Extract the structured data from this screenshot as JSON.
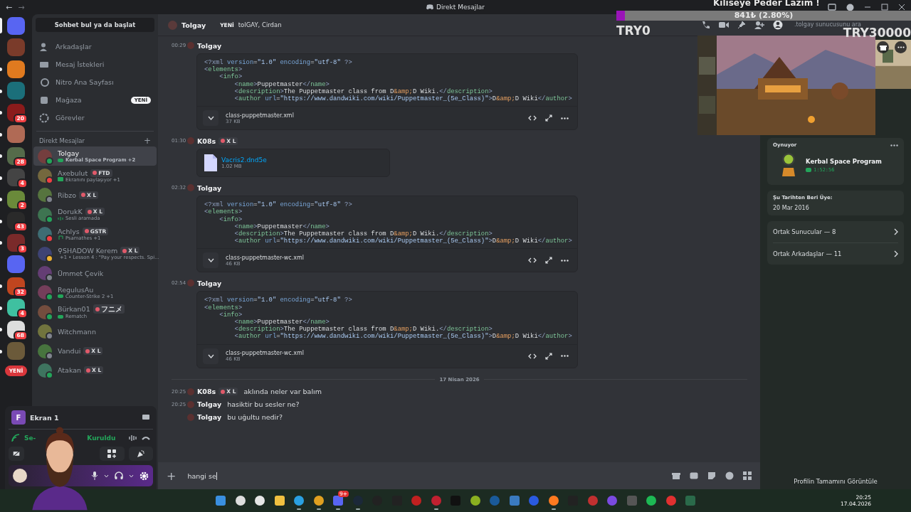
{
  "window": {
    "title": "Direkt Mesajlar",
    "back": "←",
    "forward": "→"
  },
  "overlay": {
    "goal_title": "Kiliseye Peder Lazım !",
    "goal_amount": "841₺ (2.80%)",
    "level": 0.028,
    "goal_min": "TRY0",
    "goal_max": "TRY30000"
  },
  "servers": [
    {
      "unread": false,
      "selected": true
    },
    {
      "unread": false,
      "selected": false
    },
    {
      "unread": true,
      "selected": false
    },
    {
      "unread": true,
      "selected": false
    },
    {
      "unread": true,
      "badge": "20",
      "selected": false
    },
    {
      "unread": true,
      "selected": false
    },
    {
      "unread": true,
      "badge": "28",
      "selected": false
    },
    {
      "unread": true,
      "badge": "4",
      "selected": false
    },
    {
      "unread": true,
      "badge": "2",
      "selected": false
    },
    {
      "unread": true,
      "badge": "43",
      "selected": false
    },
    {
      "unread": true,
      "badge": "3",
      "selected": false
    },
    {
      "unread": false,
      "selected": false
    },
    {
      "unread": true,
      "badge": "32",
      "selected": false
    },
    {
      "unread": true,
      "badge": "4",
      "selected": false
    },
    {
      "unread": true,
      "badge": "68",
      "selected": false
    },
    {
      "unread": true,
      "selected": false
    }
  ],
  "new_button": "YENİ",
  "sidebar": {
    "search": "Sohbet bul ya da başlat",
    "nav": [
      {
        "label": "Arkadaşlar"
      },
      {
        "label": "Mesaj İstekleri"
      },
      {
        "label": "Nitro Ana Sayfası"
      },
      {
        "label": "Mağaza",
        "badge": "YENİ"
      },
      {
        "label": "Görevler"
      }
    ],
    "dm_header": "Direkt Mesajlar",
    "dm_add": "+",
    "dms": [
      {
        "name": "Tolgay",
        "color": "#23a55a",
        "activity": {
          "kind": "game",
          "text": "Kerbal Space Program +2"
        },
        "selected": true
      },
      {
        "name": "Axebulut",
        "color": "#f23f43",
        "tag": "FTD",
        "activity": {
          "kind": "screen",
          "text": "Ekranını paylaşıyor +1"
        },
        "selected": false
      },
      {
        "name": "Ribzo",
        "color": "#80848e",
        "tag": "X L",
        "selected": false
      },
      {
        "name": "DorukK",
        "color": "#23a55a",
        "tag": "X L",
        "activity": {
          "kind": "voice",
          "text": "Sesli aramada"
        },
        "selected": false
      },
      {
        "name": "Achlys",
        "color": "#f23f43",
        "tag": "GSTR",
        "activity": {
          "kind": "music",
          "text": "Psamathes +1"
        },
        "selected": false
      },
      {
        "name": "⚲SHADOW Kerem",
        "color": "#f0b232",
        "tag": "X L",
        "activity": {
          "kind": "music",
          "text": "+1 • Lesson 4 : \"Pay your respects. Spi..."
        },
        "selected": false
      },
      {
        "name": "Ümmet Çevik",
        "color": "#80848e",
        "selected": false
      },
      {
        "name": "RegulusAu",
        "color": "#23a55a",
        "activity": {
          "kind": "game",
          "text": "Counter-Strike 2 +1"
        },
        "selected": false
      },
      {
        "name": "Bürkan01",
        "color": "#23a55a",
        "tag": "フニメ",
        "activity": {
          "kind": "game",
          "text": "Rematch"
        },
        "selected": false
      },
      {
        "name": "Witchmann",
        "color": "#80848e",
        "selected": false
      },
      {
        "name": "Vandui",
        "color": "#80848e",
        "tag": "X L",
        "selected": false
      },
      {
        "name": "Atakan",
        "color": "#23a55a",
        "tag": "X L",
        "selected": false
      }
    ]
  },
  "voice": {
    "stream_title": "Ekran 1",
    "stream_initial": "F",
    "status_start": "Se-",
    "status_end": "Kuruldu"
  },
  "chat": {
    "name": "Tolgay",
    "badge": "YENİ",
    "members": "tolGAY, Cirdan",
    "search": ".tolgay sunucusunu ara",
    "messages": [
      {
        "kind": "code",
        "time": "00:29",
        "author": "Tolgay",
        "file": "class-puppetmaster.xml",
        "size": "37 KB",
        "lines": [
          "<?xml version=\"1.0\" encoding=\"utf-8\" ?>",
          "<elements>",
          "    <info>",
          "        <name>Puppetmaster</name>",
          "        <description>The Puppetmaster class from D&amp;D Wiki.</description>",
          "        <author url=\"https://www.dandwiki.com/wiki/Puppetmaster_(5e_Class)\">D&amp;D Wiki</author>"
        ]
      },
      {
        "kind": "file",
        "time": "01:30",
        "author": "K08s",
        "tag": "X L",
        "file": "Vacris2.dnd5e",
        "size": "1.02 MB"
      },
      {
        "kind": "code",
        "time": "02:32",
        "author": "Tolgay",
        "file": "class-puppetmaster-wc.xml",
        "size": "46 KB",
        "lines": [
          "<?xml version=\"1.0\" encoding=\"utf-8\" ?>",
          "<elements>",
          "    <info>",
          "        <name>Puppetmaster</name>",
          "        <description>The Puppetmaster class from D&amp;D Wiki.</description>",
          "        <author url=\"https://www.dandwiki.com/wiki/Puppetmaster_(5e_Class)\">D&amp;D Wiki</author>"
        ]
      },
      {
        "kind": "code",
        "time": "02:54",
        "author": "Tolgay",
        "file": "class-puppetmaster-wc.xml",
        "size": "46 KB",
        "lines": [
          "<?xml version=\"1.0\" encoding=\"utf-8\" ?>",
          "<elements>",
          "    <info>",
          "        <name>Puppetmaster</name>",
          "        <description>The Puppetmaster class from D&amp;D Wiki.</description>",
          "        <author url=\"https://www.dandwiki.com/wiki/Puppetmaster_(5e_Class)\">D&amp;D Wiki</author>"
        ]
      },
      {
        "kind": "date",
        "text": "17 Nisan 2026"
      },
      {
        "kind": "text",
        "time": "20:25",
        "author": "K08s",
        "tag": "X L",
        "text": "aklında neler var balım"
      },
      {
        "kind": "text",
        "time": "20:25",
        "author": "Tolgay",
        "text": "hasiktir bu sesler ne?"
      },
      {
        "kind": "text",
        "author": "Tolgay",
        "text": "bu uğultu nedir?"
      }
    ],
    "composer": {
      "attach": "+",
      "value": "hangi se"
    }
  },
  "profile": {
    "playing_label": "Oynuyor",
    "game": "Kerbal Space Program",
    "elapsed": "1:52:56",
    "member_since_label": "Şu Tarihten Beri Üye:",
    "member_since": "20 Mar 2016",
    "links": [
      {
        "label": "Ortak Sunucular — 8"
      },
      {
        "label": "Ortak Arkadaşlar — 11"
      }
    ],
    "full_profile": "Profilin Tamamını Görüntüle"
  },
  "taskbar": {
    "apps": [
      {
        "running": false
      },
      {
        "running": false
      },
      {
        "running": false
      },
      {
        "running": false
      },
      {
        "running": true
      },
      {
        "running": true
      },
      {
        "running": true,
        "badge": "9+"
      },
      {
        "running": true
      },
      {
        "running": false
      },
      {
        "running": false
      },
      {
        "running": false
      },
      {
        "running": true
      },
      {
        "running": false
      },
      {
        "running": false
      },
      {
        "running": false
      },
      {
        "running": false
      },
      {
        "running": false
      },
      {
        "running": true
      },
      {
        "running": false
      },
      {
        "running": false
      },
      {
        "running": false
      },
      {
        "running": false
      },
      {
        "running": false
      },
      {
        "running": false
      },
      {
        "running": false
      }
    ],
    "time": "20:25",
    "date": "17.04.2026"
  }
}
